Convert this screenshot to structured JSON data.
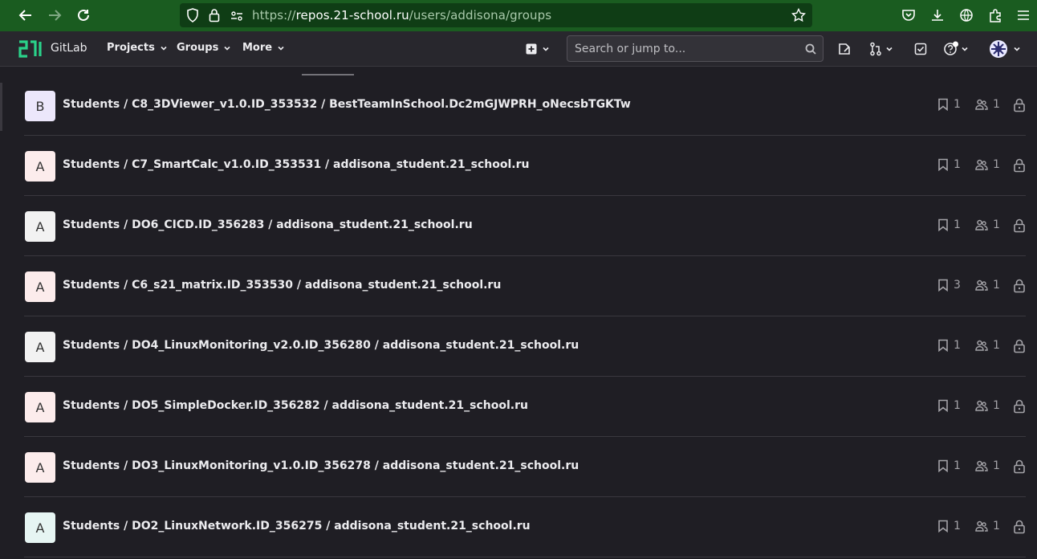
{
  "browser": {
    "url_scheme": "https://",
    "url_host": "repos.21-school.ru",
    "url_path": "/users/addisona/groups"
  },
  "header": {
    "app_name": "GitLab",
    "menus": [
      "Projects",
      "Groups",
      "More"
    ],
    "search_placeholder": "Search or jump to..."
  },
  "groups": [
    {
      "avatar": "B",
      "avatar_color": "#ece7fb",
      "path": "Students / C8_3DViewer_v1.0.ID_353532 / BestTeamInSchool.Dc2mGJWPRH_oNecsbTGKTw",
      "subgroups": "1",
      "members": "1"
    },
    {
      "avatar": "A",
      "avatar_color": "#fcecec",
      "path": "Students / C7_SmartCalc_v1.0.ID_353531 / addisona_student.21_school.ru",
      "subgroups": "1",
      "members": "1"
    },
    {
      "avatar": "A",
      "avatar_color": "#f2f2f2",
      "path": "Students / DO6_CICD.ID_356283 / addisona_student.21_school.ru",
      "subgroups": "1",
      "members": "1"
    },
    {
      "avatar": "A",
      "avatar_color": "#fcecec",
      "path": "Students / C6_s21_matrix.ID_353530 / addisona_student.21_school.ru",
      "subgroups": "3",
      "members": "1"
    },
    {
      "avatar": "A",
      "avatar_color": "#f2f2f2",
      "path": "Students / DO4_LinuxMonitoring_v2.0.ID_356280 / addisona_student.21_school.ru",
      "subgroups": "1",
      "members": "1"
    },
    {
      "avatar": "A",
      "avatar_color": "#fcecec",
      "path": "Students / DO5_SimpleDocker.ID_356282 / addisona_student.21_school.ru",
      "subgroups": "1",
      "members": "1"
    },
    {
      "avatar": "A",
      "avatar_color": "#fcecec",
      "path": "Students / DO3_LinuxMonitoring_v1.0.ID_356278 / addisona_student.21_school.ru",
      "subgroups": "1",
      "members": "1"
    },
    {
      "avatar": "A",
      "avatar_color": "#e6f5f3",
      "path": "Students / DO2_LinuxNetwork.ID_356275 / addisona_student.21_school.ru",
      "subgroups": "1",
      "members": "1"
    }
  ],
  "icons": {
    "back": "arrow-left-icon",
    "forward": "arrow-right-icon",
    "reload": "reload-icon",
    "shield": "shield-icon",
    "lock": "lock-icon",
    "bookmark_star": "star-icon",
    "subgroups": "bookmark-icon",
    "members": "users-icon",
    "visibility": "lock-icon"
  }
}
